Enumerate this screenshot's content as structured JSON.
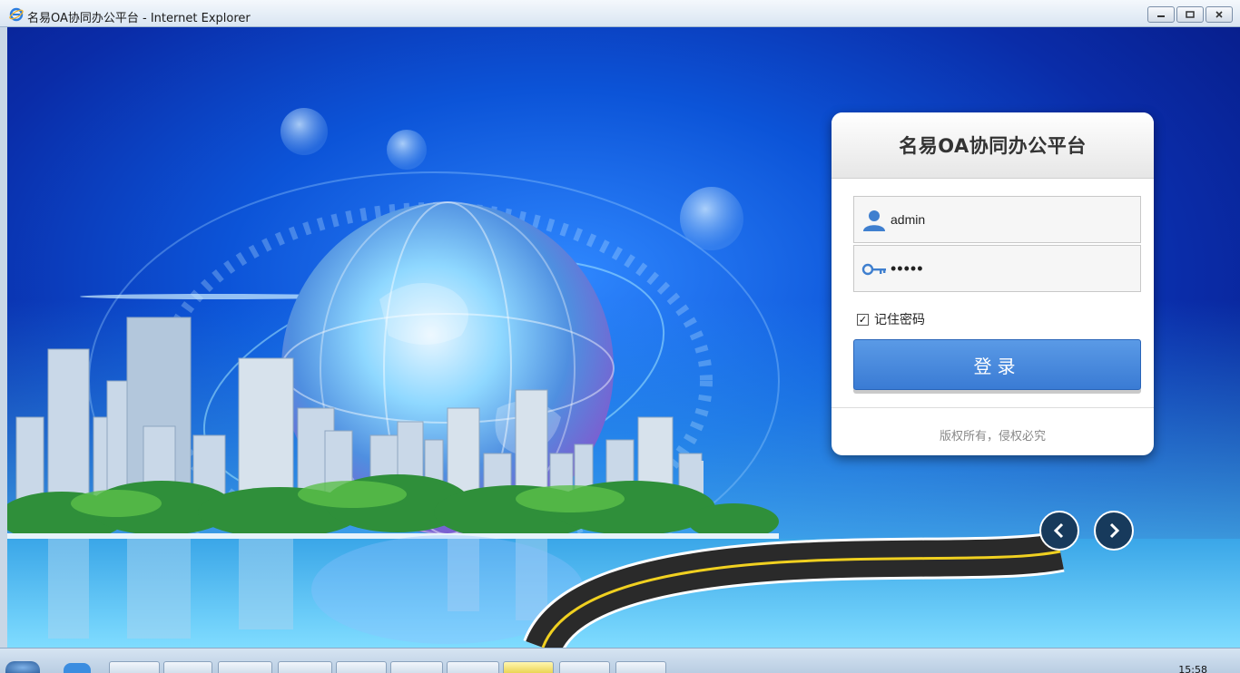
{
  "window": {
    "title": "名易OA协同办公平台 - Internet Explorer",
    "controls": [
      "minimize",
      "restore",
      "close"
    ]
  },
  "login": {
    "title": "名易OA协同办公平台",
    "username_value": "admin",
    "password_value": "•••••",
    "remember_label": "记住密码",
    "remember_checked": true,
    "submit_label": "登录",
    "copyright": "版权所有，侵权必究"
  },
  "carousel": {
    "prev_icon": "chevron-left-icon",
    "next_icon": "chevron-right-icon"
  },
  "taskbar": {
    "clock": "15:58"
  },
  "colors": {
    "button_blue": "#3a7bd4",
    "nav_button": "#173a5c",
    "background_blue": "#0c54d8"
  }
}
